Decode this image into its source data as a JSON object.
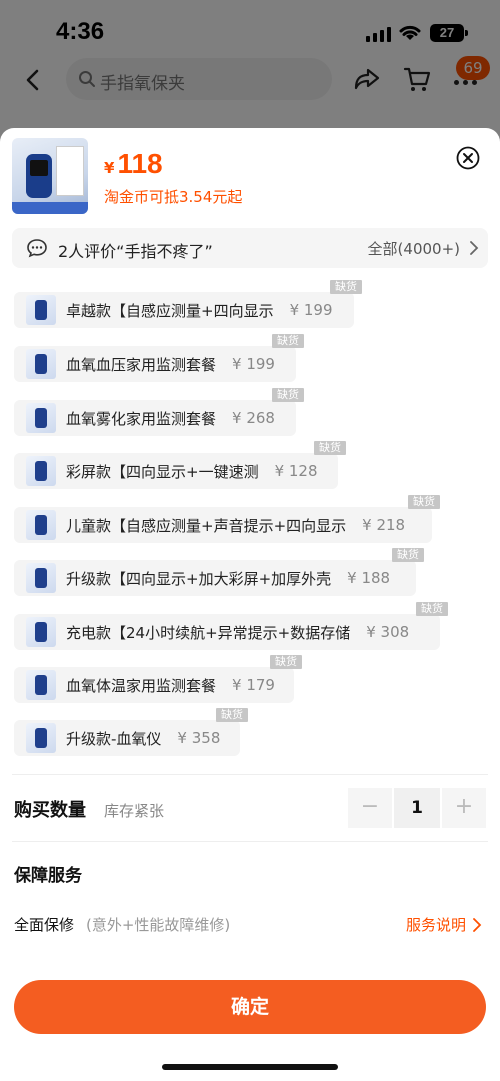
{
  "status_bar": {
    "time": "4:36",
    "battery": "27"
  },
  "nav": {
    "search_placeholder": "手指氧保夹",
    "cart_badge": "69"
  },
  "product": {
    "currency": "¥",
    "price": "118",
    "coins_note": "淘金币可抵3.54元起"
  },
  "review": {
    "text": "2人评价“手指不疼了”",
    "all": "全部(4000+)"
  },
  "stock_tag": "缺货",
  "options": [
    {
      "label": "卓越款【自感应测量+四向显示",
      "price": "¥ 199",
      "out_of_stock": true
    },
    {
      "label": "血氧血压家用监测套餐",
      "price": "¥ 199",
      "out_of_stock": true
    },
    {
      "label": "血氧雾化家用监测套餐",
      "price": "¥ 268",
      "out_of_stock": true
    },
    {
      "label": "彩屏款【四向显示+一键速测",
      "price": "¥ 128",
      "out_of_stock": true
    },
    {
      "label": "儿童款【自感应测量+声音提示+四向显示",
      "price": "¥ 218",
      "out_of_stock": true
    },
    {
      "label": "升级款【四向显示+加大彩屏+加厚外壳",
      "price": "¥ 188",
      "out_of_stock": true
    },
    {
      "label": "充电款【24小时续航+异常提示+数据存储",
      "price": "¥ 308",
      "out_of_stock": true
    },
    {
      "label": "血氧体温家用监测套餐",
      "price": "¥ 179",
      "out_of_stock": true
    },
    {
      "label": "升级款-血氧仪",
      "price": "¥ 358",
      "out_of_stock": true
    }
  ],
  "quantity": {
    "label": "购买数量",
    "stock_note": "库存紧张",
    "minus": "−",
    "value": "1",
    "plus": "+"
  },
  "guarantee": {
    "title": "保障服务",
    "warranty_label": "全面保修",
    "warranty_note": "(意外+性能故障维修)",
    "service_link": "服务说明"
  },
  "confirm_label": "确定",
  "colors": {
    "accent": "#ff5000",
    "button": "#f45d21"
  },
  "icons": [
    "back-arrow-icon",
    "search-icon",
    "share-icon",
    "cart-icon",
    "more-icon",
    "close-icon",
    "comment-icon",
    "chevron-right-icon"
  ]
}
